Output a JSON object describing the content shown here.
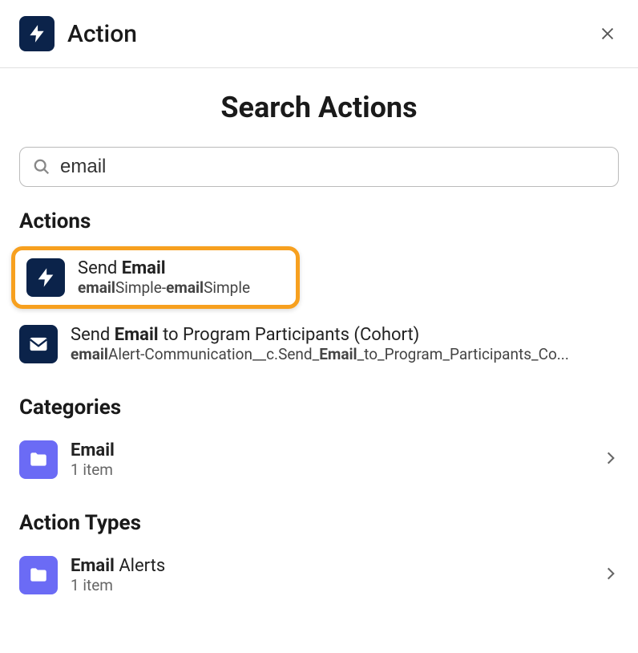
{
  "header": {
    "title": "Action"
  },
  "main_title": "Search Actions",
  "search": {
    "value": "email"
  },
  "sections": {
    "actions": {
      "title": "Actions",
      "items": [
        {
          "title_pre": "Send ",
          "title_bold": "Email",
          "title_post": "",
          "sub_b1": "email",
          "sub_t1": "Simple-",
          "sub_b2": "email",
          "sub_t2": "Simple"
        },
        {
          "title_pre": "Send ",
          "title_bold": "Email",
          "title_post": " to Program Participants (Cohort)",
          "sub_b1": "email",
          "sub_t1": "Alert-Communication__c.Send_",
          "sub_b2": "Email",
          "sub_t2": "_to_Program_Participants_Co..."
        }
      ]
    },
    "categories": {
      "title": "Categories",
      "items": [
        {
          "title_bold": "Email",
          "title_post": "",
          "meta": "1 item"
        }
      ]
    },
    "action_types": {
      "title": "Action Types",
      "items": [
        {
          "title_bold": "Email",
          "title_post": " Alerts",
          "meta": "1 item"
        }
      ]
    }
  }
}
